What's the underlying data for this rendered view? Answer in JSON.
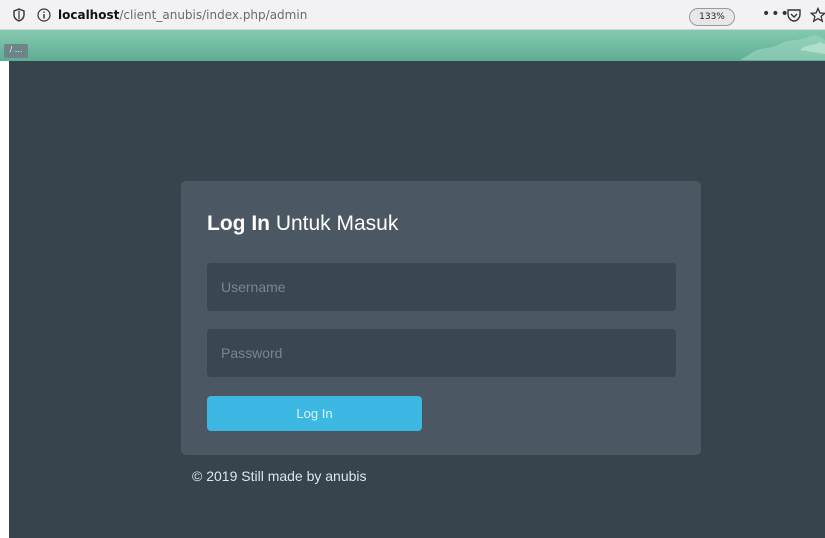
{
  "browser": {
    "url_host": "localhost",
    "url_path": "/client_anubis/index.php/admin",
    "zoom": "133%",
    "menu": "•••",
    "icons": [
      "shield-icon",
      "info-icon",
      "pocket-icon",
      "star-icon"
    ]
  },
  "band": {
    "chip": "/ ..."
  },
  "login": {
    "title_bold": "Log In",
    "title_rest": " Untuk Masuk",
    "username_placeholder": "Username",
    "password_placeholder": "Password",
    "button_label": "Log In"
  },
  "footer": {
    "text": "© 2019 Still made by anubis"
  },
  "colors": {
    "background": "#37434d",
    "card": "#4b5864",
    "input": "#3a4652",
    "button": "#3db8e2",
    "band": "#6fbba0"
  }
}
